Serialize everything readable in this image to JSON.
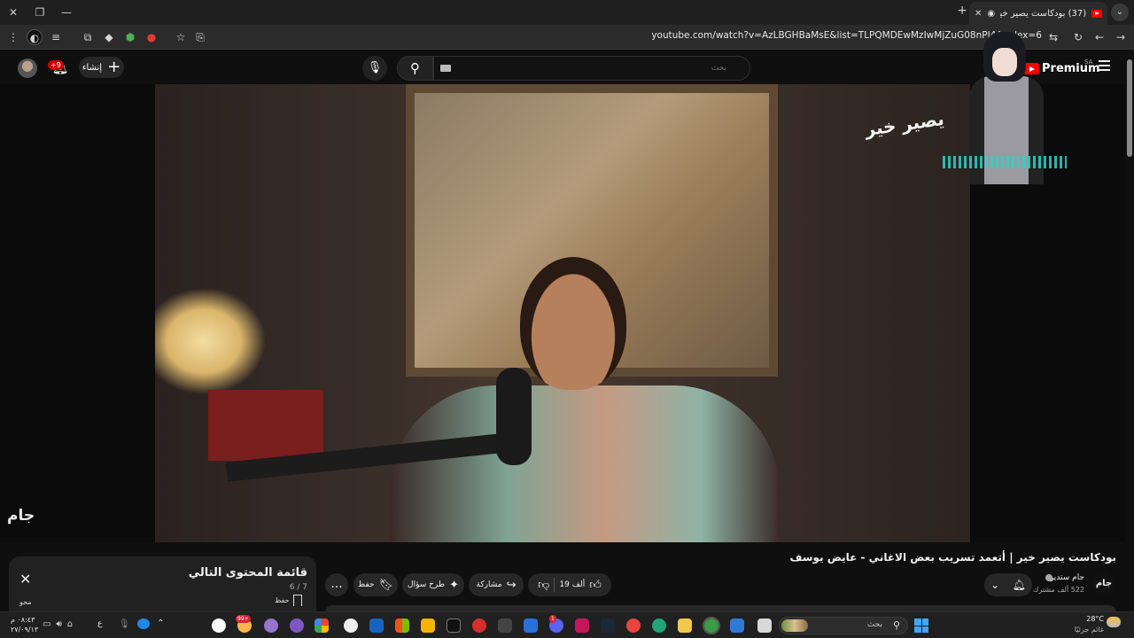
{
  "browser": {
    "tab_title": "(37) بودكاست يصير خير | أتع...",
    "url": "youtube.com/watch?v=AzLBGHBaMsE&list=TLPQMDEwMzIwMjZuG08nPI4A...dex=6",
    "new_tab": "+",
    "tab_close": "✕"
  },
  "masthead": {
    "logo_text": "Premium",
    "region": "SA",
    "search_placeholder": "بحث",
    "create_label": "إنشاء",
    "notification_count": "+9"
  },
  "video": {
    "title": "بودكاست يصير خير | أتعمد تسريب بعض الاغاني - عايض يوسف",
    "channel_name": "جام ستديو",
    "subscribers": "522 ألف مشترك",
    "channel_logo_text": "جام",
    "watermark": "جام",
    "overlay_logo": "يصير خير",
    "likes": "19 ألف",
    "share_label": "مشاركة",
    "ask_label": "طرح سؤال",
    "save_label": "حفظ",
    "more_label": "..."
  },
  "playlist": {
    "title": "قائمة المحتوى التالي",
    "count": "7 / 6",
    "save_label": "حفظ",
    "saved_label": "محو"
  },
  "taskbar": {
    "temperature": "28°C",
    "condition": "غائم جزئيًا",
    "search_label": "بحث",
    "language": "ع",
    "time": "٠٨:٤٣ م",
    "date": "٢٧/٠٩/١٣",
    "badge_1": "99+",
    "badge_2": "1"
  }
}
